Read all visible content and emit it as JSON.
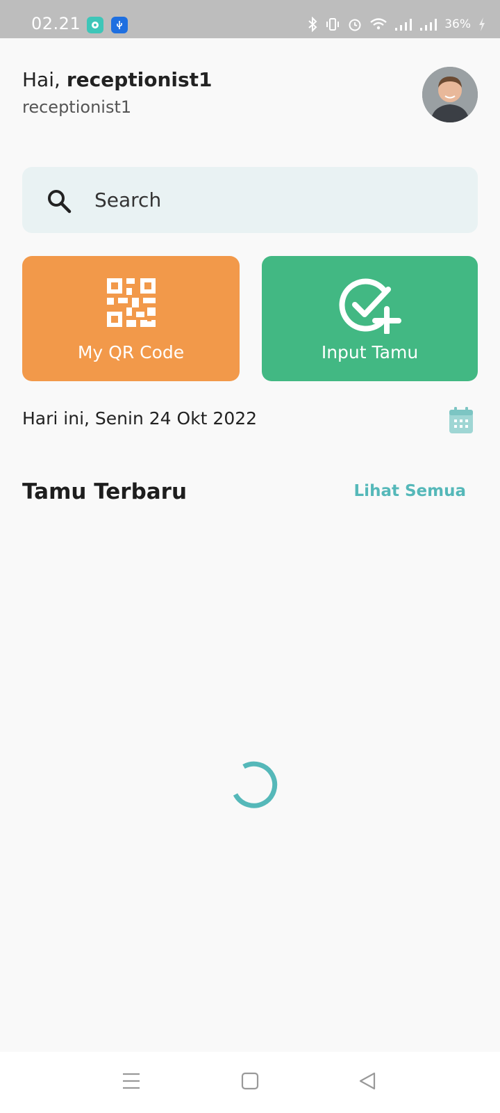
{
  "status_bar": {
    "time": "02.21",
    "battery": "36%",
    "icons": [
      "app-notification-icon",
      "usb-icon",
      "bluetooth-icon",
      "vibrate-icon",
      "alarm-icon",
      "wifi-icon",
      "signal-icon",
      "signal-icon",
      "charging-icon"
    ]
  },
  "header": {
    "greeting_prefix": "Hai,",
    "username": "receptionist1",
    "role": "receptionist1"
  },
  "search": {
    "placeholder": "Search"
  },
  "actions": {
    "qr": {
      "label": "My QR Code",
      "color": "#f2994a",
      "icon": "qr-code-icon"
    },
    "input": {
      "label": "Input Tamu",
      "color": "#42b883",
      "icon": "check-plus-icon"
    }
  },
  "date": {
    "text": "Hari ini, Senin 24 Okt 2022",
    "icon": "calendar-icon"
  },
  "section": {
    "title": "Tamu Terbaru",
    "see_all": "Lihat Semua",
    "accent": "#55b8b9"
  },
  "nav": {
    "icons": [
      "menu-icon",
      "home-icon",
      "back-icon"
    ]
  }
}
